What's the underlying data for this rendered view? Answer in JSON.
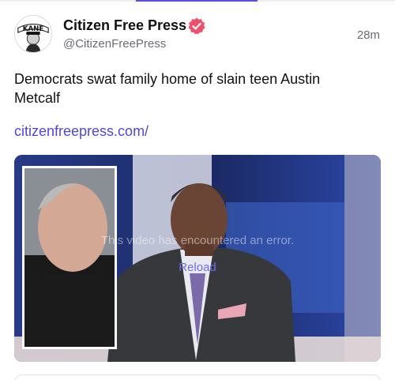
{
  "post": {
    "author_name": "Citizen Free Press",
    "author_handle": "@CitizenFreePress",
    "time": "28m",
    "text": "Democrats swat family home of slain teen Austin Metcalf",
    "link": "citizenfreepress.com/",
    "avatar_text": "KANE"
  },
  "video": {
    "error_message": "This video has encountered an error.",
    "reload_label": "Reload"
  },
  "colors": {
    "accent": "#5b4fe0",
    "link": "#5146d8",
    "verified_badge": "#f0506e",
    "muted_text": "#6b6b72"
  },
  "icons": {
    "verified": "verified-badge-icon"
  }
}
